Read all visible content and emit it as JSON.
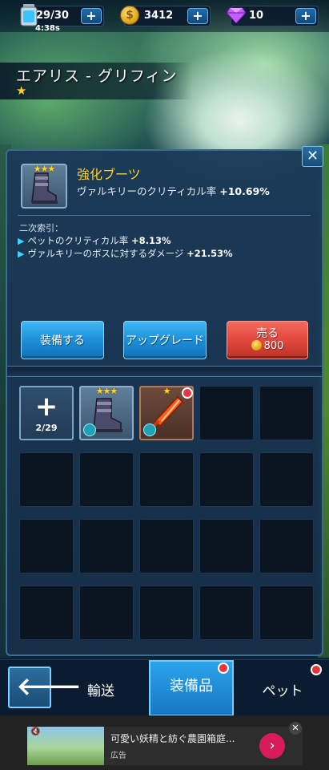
{
  "resources": {
    "energy": "29/30",
    "energy_timer": "4:38s",
    "coins": "3412",
    "gems": "10",
    "plus": "+"
  },
  "hero": {
    "name": "エアリス - グリフィン",
    "star": "★"
  },
  "item": {
    "stars": "★★★",
    "name": "強化ブーツ",
    "main_stat_label": "ヴァルキリーのクリティカル率",
    "main_stat_value": "+10.69%",
    "secondary_header": "二次索引：",
    "secondary": [
      {
        "label": "ペットのクリティカル率",
        "value": "+8.13%"
      },
      {
        "label": "ヴァルキリーのボスに対するダメージ",
        "value": "+21.53%"
      }
    ]
  },
  "buttons": {
    "equip": "装備する",
    "upgrade": "アップグレード",
    "sell": "売る",
    "sell_price": "800"
  },
  "inventory": {
    "capacity": "2/29",
    "add_symbol": "+",
    "item1_stars": "★★★",
    "item2_stars": "★"
  },
  "nav": {
    "back": "🡐",
    "tabs": [
      "輸送",
      "装備品",
      "ペット"
    ]
  },
  "ad": {
    "title": "可愛い妖精と紡ぐ農園箱庭...",
    "label": "広告",
    "cta": "›",
    "close": "✕"
  },
  "colors": {
    "accent_blue": "#1b8cd6",
    "sell_red": "#e0453a",
    "gold": "#ffcf2a",
    "stat_arrow": "#3ed0ff"
  }
}
